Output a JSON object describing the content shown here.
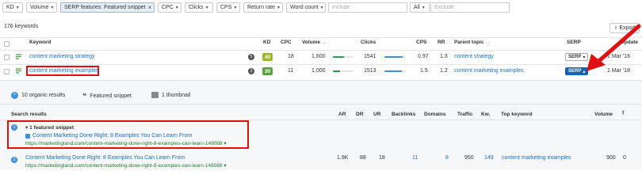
{
  "filters": {
    "kd": "KD",
    "volume": "Volume",
    "serp_features": "SERP features: Featured snippet",
    "cpc": "CPC",
    "clicks": "Clicks",
    "cps": "CPS",
    "return_rate": "Return rate",
    "word_count": "Word count",
    "include_placeholder": "Include",
    "all": "All",
    "exclude_placeholder": "Exclude"
  },
  "keywords_count": "176 keywords",
  "export_label": "Export",
  "table": {
    "headers": {
      "keyword": "Keyword",
      "kd": "KD",
      "cpc": "CPC",
      "volume": "Volume",
      "clicks": "Clicks",
      "cps": "CPS",
      "rr": "RR",
      "parent_topic": "Parent topic",
      "serp": "SERP",
      "update": "Update"
    },
    "rows": [
      {
        "keyword": "content marketing strategy",
        "kd_num": "5",
        "kd": "40",
        "kd_color": "#9ab82c",
        "cpc": "18",
        "volume": "1,600",
        "volume_trend": 0.55,
        "clicks": "1541",
        "clicks_trend": 0.9,
        "cps": "0.97",
        "rr": "1.3",
        "parent_topic": "content strategy",
        "serp": "SERP",
        "update": "1 Mar '18"
      },
      {
        "keyword": "content marketing examples",
        "kd_num": "2",
        "kd": "30",
        "kd_color": "#5aa63e",
        "cpc": "11",
        "volume": "1,000",
        "volume_trend": 0.35,
        "clicks": "1513",
        "clicks_trend": 0.85,
        "cps": "1.5",
        "rr": "1.2",
        "parent_topic": "content marketing examples",
        "serp": "SERP",
        "update": "1 Mar '18"
      }
    ]
  },
  "panel": {
    "tabs": {
      "organic": "10 organic results",
      "snippet": "Featured snippet",
      "thumbnail": "1 thumbnail"
    },
    "headers": {
      "search_results": "Search results",
      "ar": "AR",
      "dr": "DR",
      "ur": "UR",
      "backlinks": "Backlinks",
      "domains": "Domains",
      "traffic": "Traffic",
      "kw": "Kw.",
      "top_keyword": "Top keyword",
      "volume": "Volume"
    },
    "results": [
      {
        "num": "1",
        "label": "▾ 1 featured snippet",
        "title": "Content Marketing Done Right: 8 Examples You Can Learn From",
        "url": "https://marketingland.com/content-marketing-done-right-8-examples-can-learn-149088 ▾"
      },
      {
        "num": "2",
        "title": "Content Marketing Done Right: 8 Examples You Can Learn From",
        "url": "https://marketingland.com/content-marketing-done-right-8-examples-can-learn-149088 ▾",
        "ar": "1.9K",
        "dr": "88",
        "ur": "18",
        "backlinks": "11",
        "domains": "8",
        "traffic": "950",
        "kw": "149",
        "top_keyword": "content marketing examples",
        "volume": "900",
        "extra": "0"
      }
    ]
  },
  "colors": {
    "accent_blue": "#1b6fc1",
    "highlight_red": "#e01010",
    "serp_active": "#1464b4"
  }
}
